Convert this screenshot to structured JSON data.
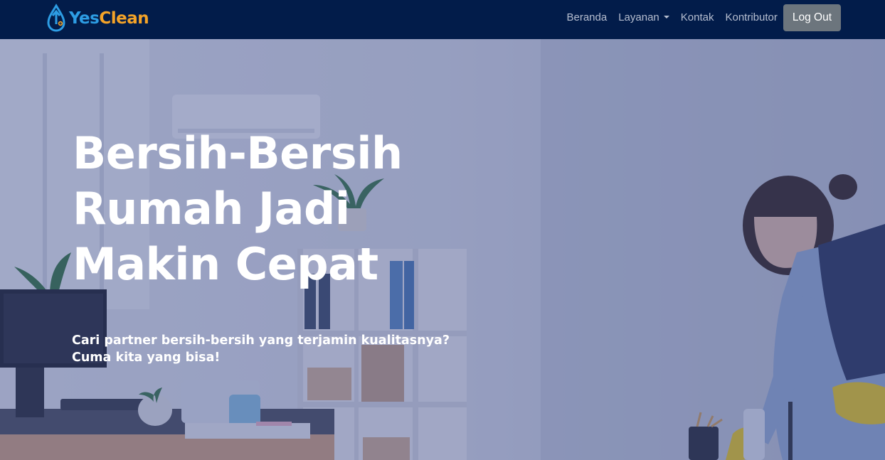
{
  "brand": {
    "name_part1": "Yes",
    "name_part2": "Clean",
    "icon": "water-drop-logo-icon"
  },
  "nav": {
    "items": [
      {
        "label": "Beranda"
      },
      {
        "label": "Layanan",
        "dropdown": true
      },
      {
        "label": "Kontak"
      },
      {
        "label": "Kontributor"
      }
    ],
    "logout_label": "Log Out"
  },
  "hero": {
    "title_lines": [
      "Bersih-Bersih",
      "Rumah Jadi",
      "Makin Cepat"
    ],
    "subtitle_lines": [
      "Cari partner bersih-bersih yang terjamin kualitasnya?",
      "Cuma kita yang bisa!"
    ],
    "background_image": "office-cleaning-photo"
  },
  "colors": {
    "navbar_bg": "#021c4a",
    "brand_blue": "#2d9de4",
    "brand_orange": "#f4a328",
    "logout_bg": "#6c757d",
    "nav_link": "#b6bed0"
  }
}
